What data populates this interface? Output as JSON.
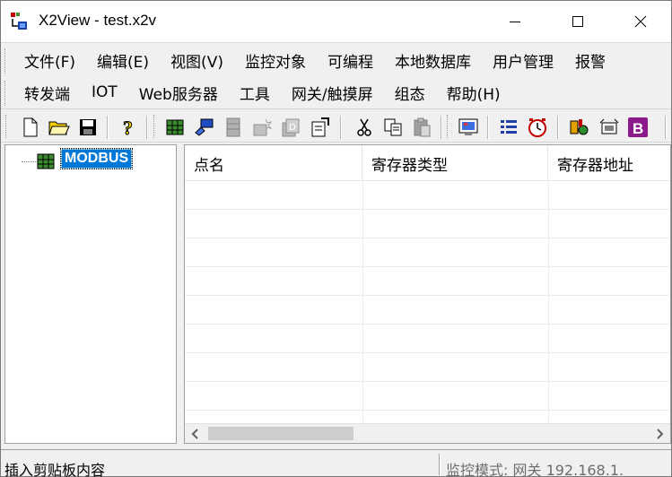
{
  "window": {
    "title": "X2View - test.x2v"
  },
  "menu": {
    "row1": [
      "文件(F)",
      "编辑(E)",
      "视图(V)",
      "监控对象",
      "可编程",
      "本地数据库",
      "用户管理",
      "报警"
    ],
    "row2": [
      "转发端",
      "IOT",
      "Web服务器",
      "工具",
      "网关/触摸屏",
      "组态",
      "帮助(H)"
    ]
  },
  "toolbar": {
    "icons": [
      "new-file-icon",
      "open-folder-icon",
      "save-icon",
      "help-icon",
      "database-icon",
      "connect-icon",
      "device-gray-icon",
      "device-spark-icon",
      "device-d-icon",
      "properties-icon",
      "cut-icon",
      "copy-icon",
      "paste-icon",
      "monitor-icon",
      "list-icon",
      "clock-icon",
      "tools-icon",
      "config-icon",
      "bold-b-icon"
    ]
  },
  "tree": {
    "root_label": "MODBUS"
  },
  "table": {
    "columns": [
      "点名",
      "寄存器类型",
      "寄存器地址"
    ],
    "rows": []
  },
  "status": {
    "left": "插入剪贴板内容",
    "right": "监控模式: 网关 192.168.1."
  },
  "colors": {
    "selection": "#0078d7",
    "background": "#f0f0f0"
  }
}
